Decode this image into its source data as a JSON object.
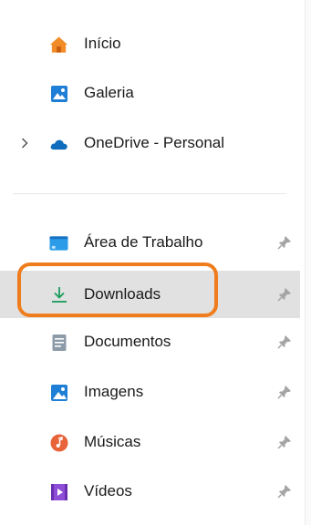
{
  "navigation": {
    "quick": [
      {
        "label": "Início",
        "icon": "home-icon"
      },
      {
        "label": "Galeria",
        "icon": "gallery-icon"
      },
      {
        "label": "OneDrive - Personal",
        "icon": "onedrive-cloud-icon",
        "expandable": true
      }
    ],
    "pinned": [
      {
        "label": "Área de Trabalho",
        "icon": "desktop-folder-icon",
        "pinned": true
      },
      {
        "label": "Downloads",
        "icon": "download-icon",
        "pinned": true,
        "selected": true
      },
      {
        "label": "Documentos",
        "icon": "documents-icon",
        "pinned": true
      },
      {
        "label": "Imagens",
        "icon": "pictures-icon",
        "pinned": true
      },
      {
        "label": "Músicas",
        "icon": "music-icon",
        "pinned": true
      },
      {
        "label": "Vídeos",
        "icon": "videos-icon",
        "pinned": true
      }
    ]
  },
  "colors": {
    "selected_background": "#e1e1e1",
    "annotation_highlight": "#f07d1d",
    "download_accent": "#1a9c5b"
  }
}
